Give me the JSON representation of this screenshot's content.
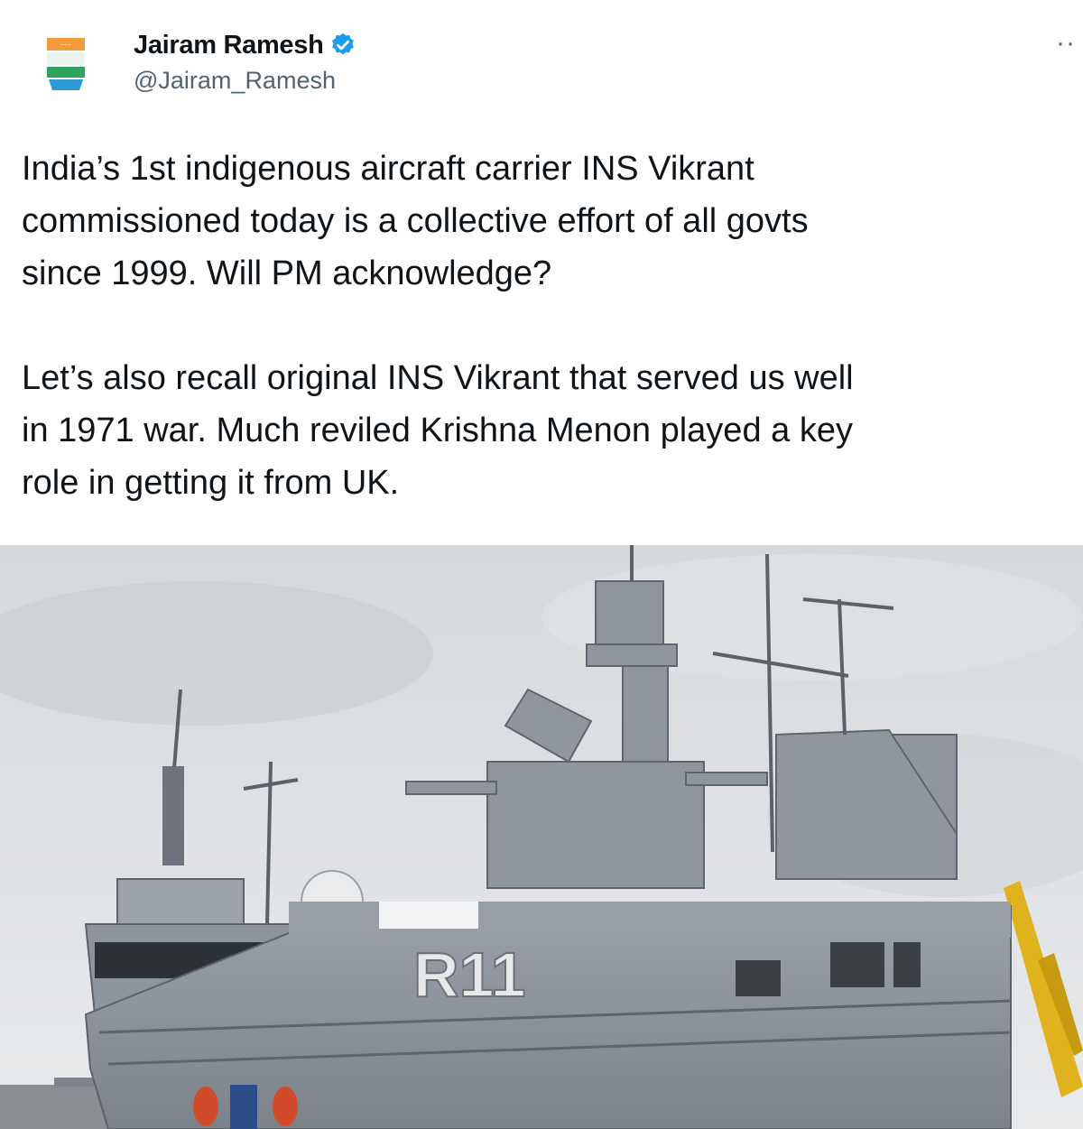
{
  "tweet": {
    "display_name": "Jairam Ramesh",
    "handle": "@Jairam_Ramesh",
    "more_label": "··",
    "paragraphs": [
      "India’s 1st indigenous aircraft carrier INS Vikrant commissioned today is a collective effort of all govts since 1999. Will PM acknowledge?",
      "Let’s also recall original INS Vikrant that served us well in 1971 war. Much reviled Krishna Menon played a key role in getting it from UK."
    ],
    "paragraph_lines": [
      [
        "India’s 1st indigenous aircraft carrier INS Vikrant",
        "commissioned today is a collective effort of all govts",
        "since 1999. Will PM acknowledge?"
      ],
      [
        "Let’s also recall original INS Vikrant that served us well",
        "in 1971 war. Much reviled Krishna Menon played a key",
        "role in getting it from UK."
      ]
    ],
    "media": {
      "hull_number": "R11"
    }
  },
  "colors": {
    "verified_badge": "#1d9bf0",
    "secondary_text": "#536471",
    "hull_gray": "#8e959c"
  },
  "icons": {
    "avatar": "party-logo-avatar",
    "verified": "verified-badge-icon",
    "more": "more-options-icon"
  }
}
